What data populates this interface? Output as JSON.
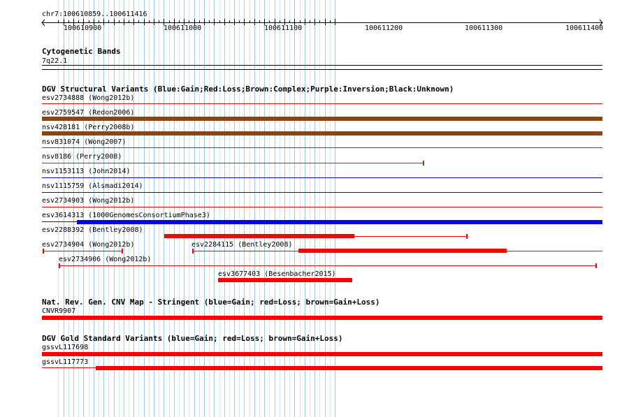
{
  "location": "chr7:100610859..100611416",
  "ruler": {
    "labels": [
      "100610900",
      "100611000",
      "100611100",
      "100611200",
      "100611300",
      "100611400"
    ]
  },
  "cytoband": {
    "title": "Cytogenetic Bands",
    "band": "7q22.1"
  },
  "dgv": {
    "title": "DGV Structural Variants (Blue:Gain;Red:Loss;Brown:Complex;Purple:Inversion;Black:Unknown)",
    "features": [
      {
        "label": "esv2734888 (Wong2012b)",
        "type": "Loss",
        "color": "#ff0000"
      },
      {
        "label": "esv2759547 (Redon2006)",
        "type": "Complex",
        "color": "#8b4513"
      },
      {
        "label": "nsv428181 (Perry2008b)",
        "type": "Complex",
        "color": "#8b4513"
      },
      {
        "label": "nsv831074 (Wong2007)",
        "type": "Loss",
        "color": "#ff0000"
      },
      {
        "label": "nsv8186 (Perry2008)",
        "type": "Complex",
        "color": "#8b4513"
      },
      {
        "label": "nsv1153113 (John2014)",
        "type": "Gain",
        "color": "#0000ff"
      },
      {
        "label": "nsv1115759 (Alsmadi2014)",
        "type": "Gain",
        "color": "#0000ff"
      },
      {
        "label": "esv2734903 (Wong2012b)",
        "type": "Loss",
        "color": "#ff0000"
      },
      {
        "label": "esv3614313 (1000GenomesConsortiumPhase3)",
        "type": "Gain",
        "color": "#0000ff"
      },
      {
        "label": "esv2288392 (Bentley2008)",
        "type": "Loss",
        "color": "#ff0000"
      },
      {
        "label": "esv2734904 (Wong2012b)",
        "type": "Loss",
        "color": "#ff0000"
      },
      {
        "label": "esv2284115 (Bentley2008)",
        "type": "Loss",
        "color": "#ff0000"
      },
      {
        "label": "esv2734906 (Wong2012b)",
        "type": "Loss",
        "color": "#ff0000"
      },
      {
        "label": "esv3677403 (Besenbacher2015)",
        "type": "Loss",
        "color": "#ff0000"
      }
    ]
  },
  "cnvmap": {
    "title": "Nat. Rev. Gen. CNV Map - Stringent (blue=Gain; red=Loss; brown=Gain+Loss)",
    "features": [
      {
        "label": "CNVR9907",
        "type": "Loss",
        "color": "#ff0000"
      }
    ]
  },
  "gold": {
    "title": "DGV Gold Standard Variants (blue=Gain; red=Loss; brown=Gain+Loss)",
    "features": [
      {
        "label": "gssvL117698",
        "type": "Loss",
        "color": "#ff0000"
      },
      {
        "label": "gssvL117773",
        "type": "Loss",
        "color": "#ff0000"
      }
    ]
  }
}
